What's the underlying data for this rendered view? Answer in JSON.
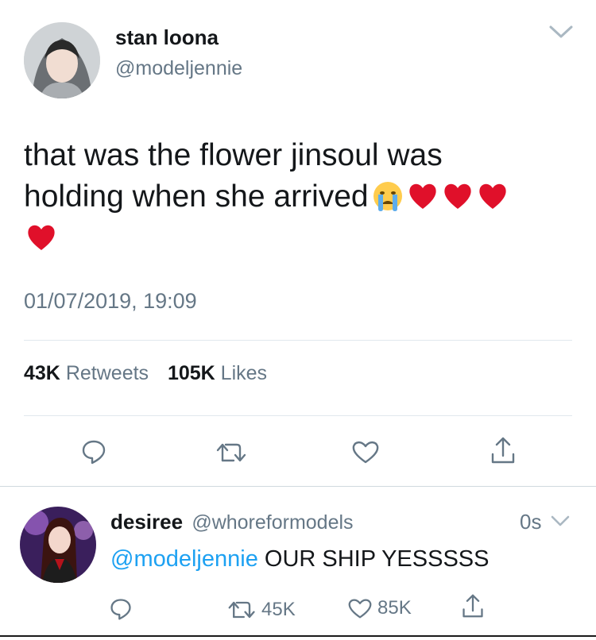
{
  "tweet": {
    "display_name": "stan loona",
    "handle": "@modeljennie",
    "text_line1": "that was the flower jinsoul was",
    "text_line2": "holding when she arrived",
    "emojis": [
      "crying-face",
      "red-heart",
      "red-heart",
      "red-heart",
      "red-heart"
    ],
    "timestamp": "01/07/2019, 19:09",
    "retweets_count": "43K",
    "retweets_label": "Retweets",
    "likes_count": "105K",
    "likes_label": "Likes"
  },
  "reply": {
    "display_name": "desiree",
    "handle": "@whoreformodels",
    "time": "0s",
    "mention": "@modeljennie",
    "text": " OUR SHIP YESSSSS",
    "retweets": "45K",
    "likes": "85K"
  },
  "colors": {
    "accent": "#1da1f2",
    "secondary_text": "#657786",
    "divider": "#e1e8ed",
    "heart": "#e0102a"
  }
}
